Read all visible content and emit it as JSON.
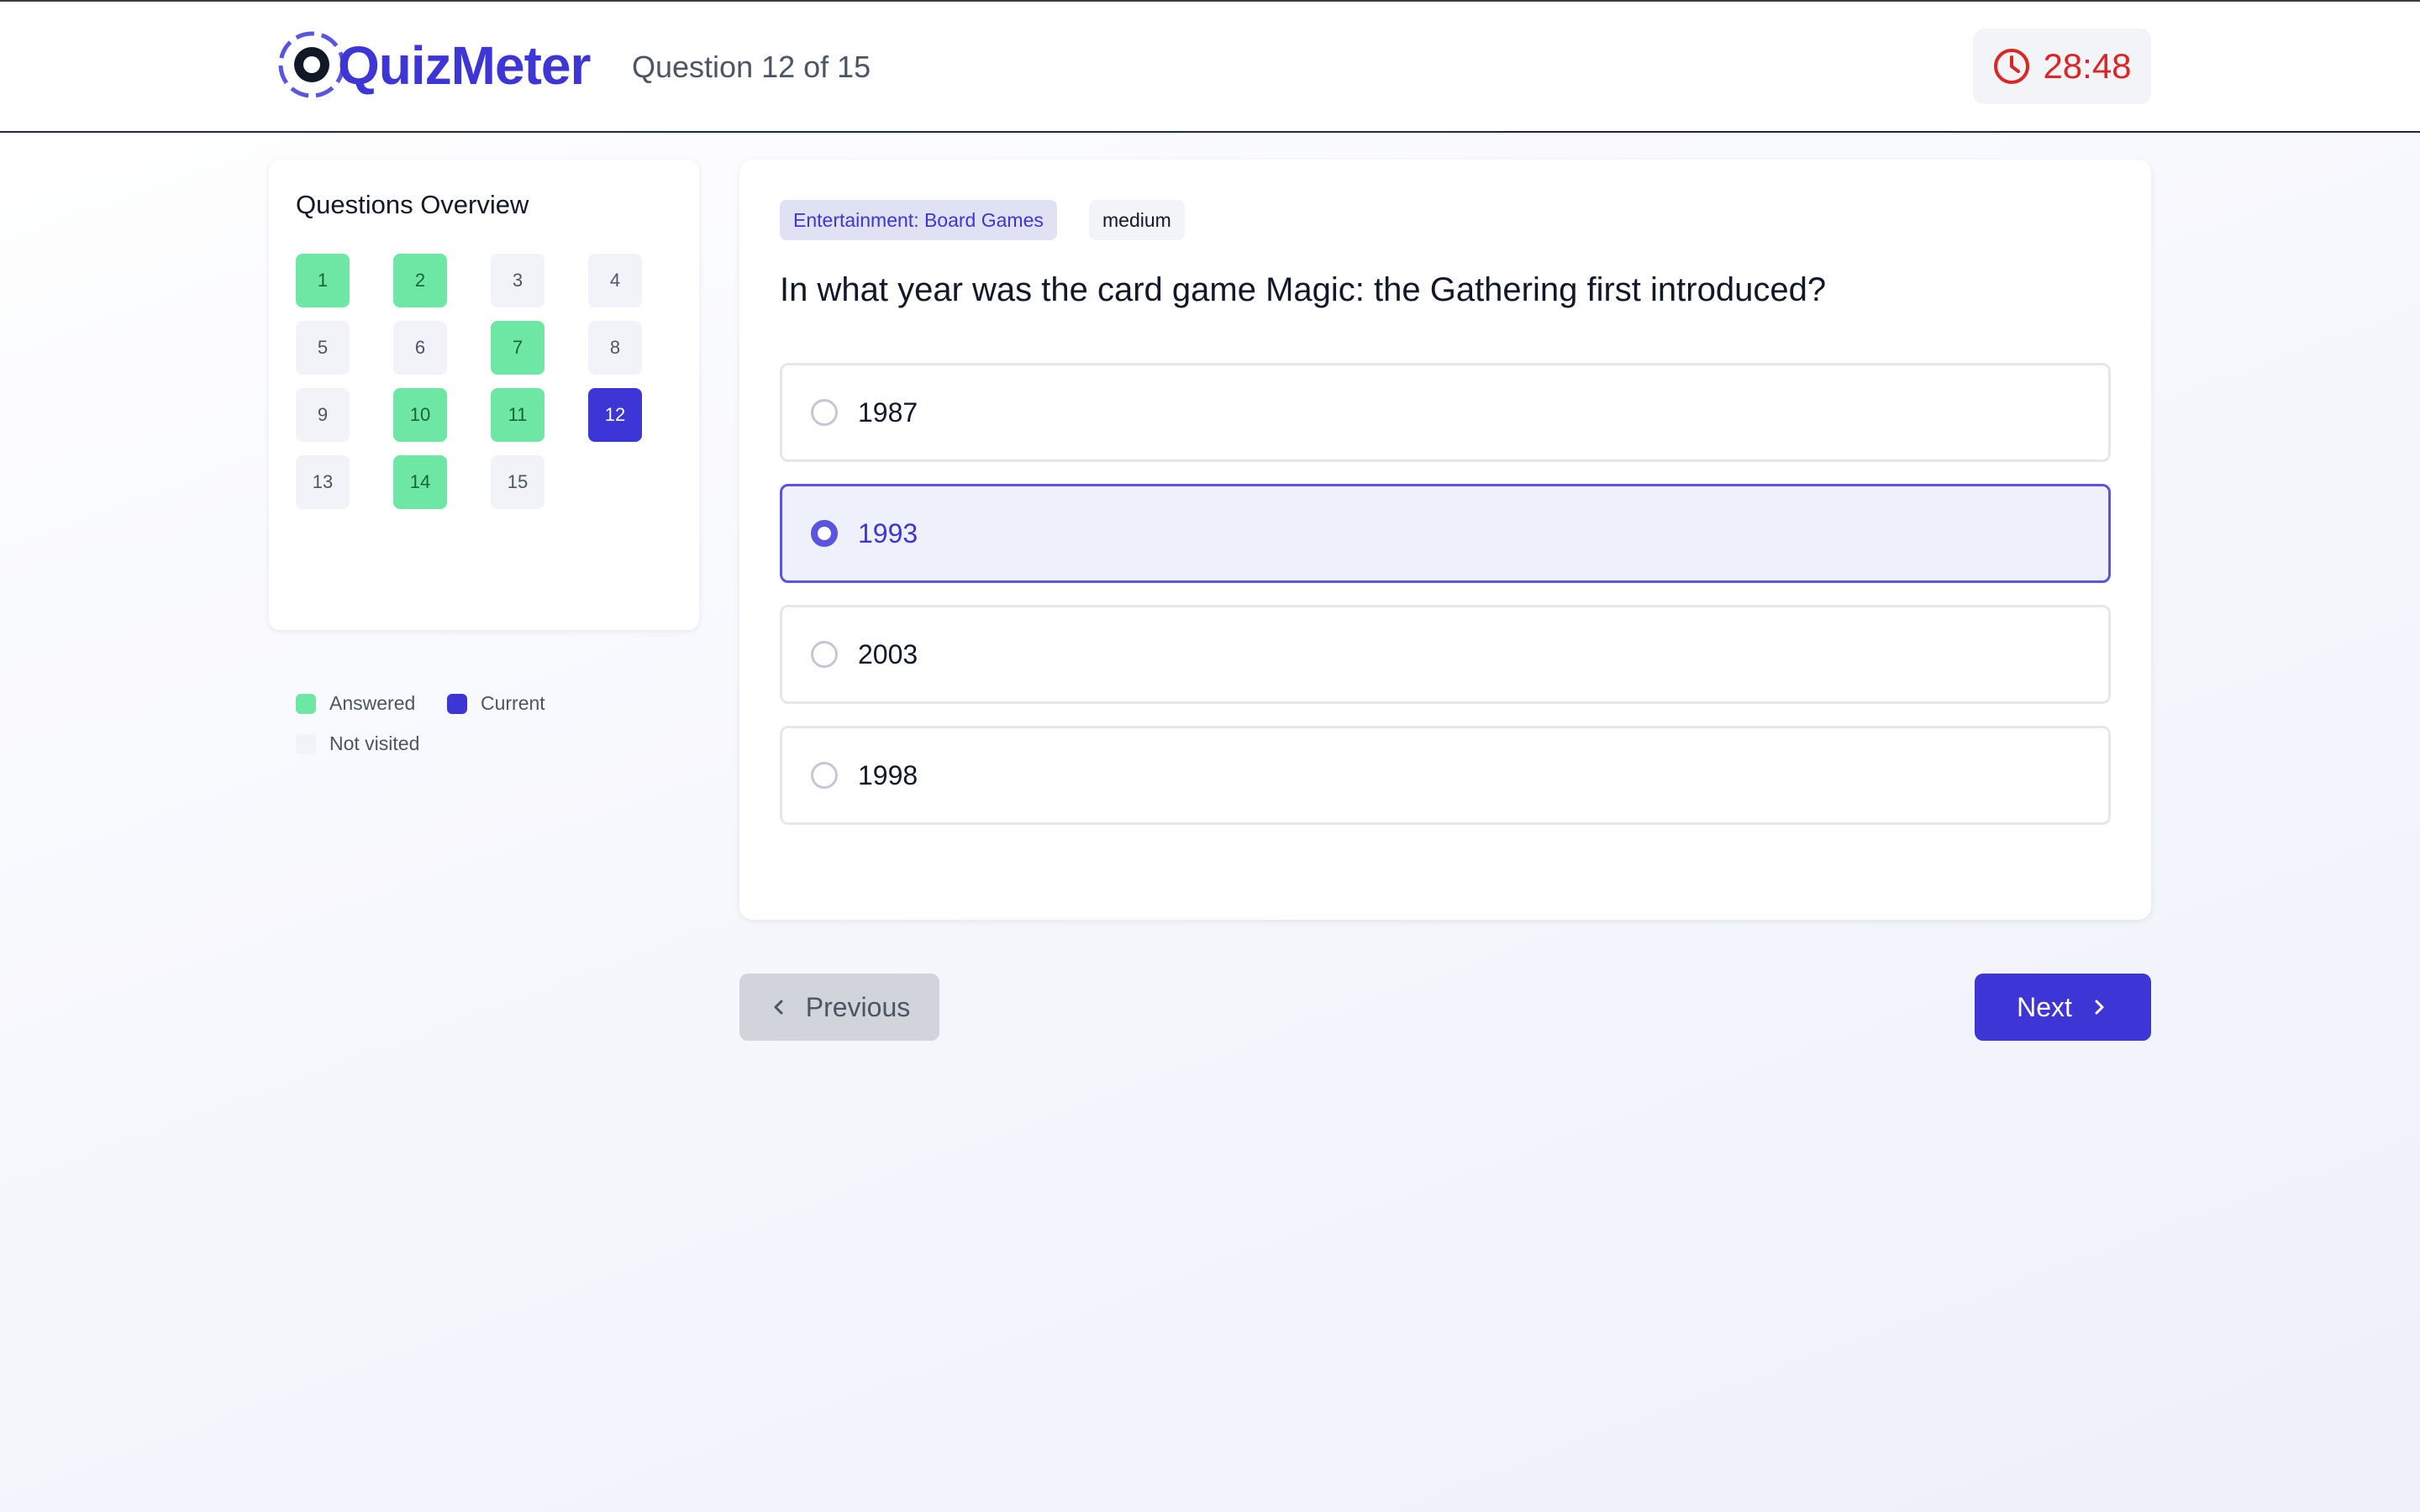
{
  "app": {
    "brand": "QuizMeter",
    "progress_text": "Question 12 of 15"
  },
  "timer": {
    "value": "28:48",
    "color": "#dc2626"
  },
  "overview": {
    "title": "Questions Overview",
    "questions": [
      {
        "n": "1",
        "state": "answered"
      },
      {
        "n": "2",
        "state": "answered"
      },
      {
        "n": "3",
        "state": "not-visited"
      },
      {
        "n": "4",
        "state": "not-visited"
      },
      {
        "n": "5",
        "state": "not-visited"
      },
      {
        "n": "6",
        "state": "not-visited"
      },
      {
        "n": "7",
        "state": "answered"
      },
      {
        "n": "8",
        "state": "not-visited"
      },
      {
        "n": "9",
        "state": "not-visited"
      },
      {
        "n": "10",
        "state": "answered"
      },
      {
        "n": "11",
        "state": "answered"
      },
      {
        "n": "12",
        "state": "current"
      },
      {
        "n": "13",
        "state": "not-visited"
      },
      {
        "n": "14",
        "state": "answered"
      },
      {
        "n": "15",
        "state": "not-visited"
      }
    ],
    "legend": {
      "answered": "Answered",
      "current": "Current",
      "not_visited": "Not visited"
    }
  },
  "question": {
    "category": "Entertainment: Board Games",
    "difficulty": "medium",
    "text": "In what year was the card game Magic: the Gathering first introduced?",
    "options": [
      {
        "label": "1987",
        "selected": false
      },
      {
        "label": "1993",
        "selected": true
      },
      {
        "label": "2003",
        "selected": false
      },
      {
        "label": "1998",
        "selected": false
      }
    ]
  },
  "nav": {
    "previous_label": "Previous",
    "next_label": "Next"
  },
  "colors": {
    "accent": "#3d35d6",
    "answered": "#6ee7a4",
    "not_visited": "#f1f3f9"
  }
}
